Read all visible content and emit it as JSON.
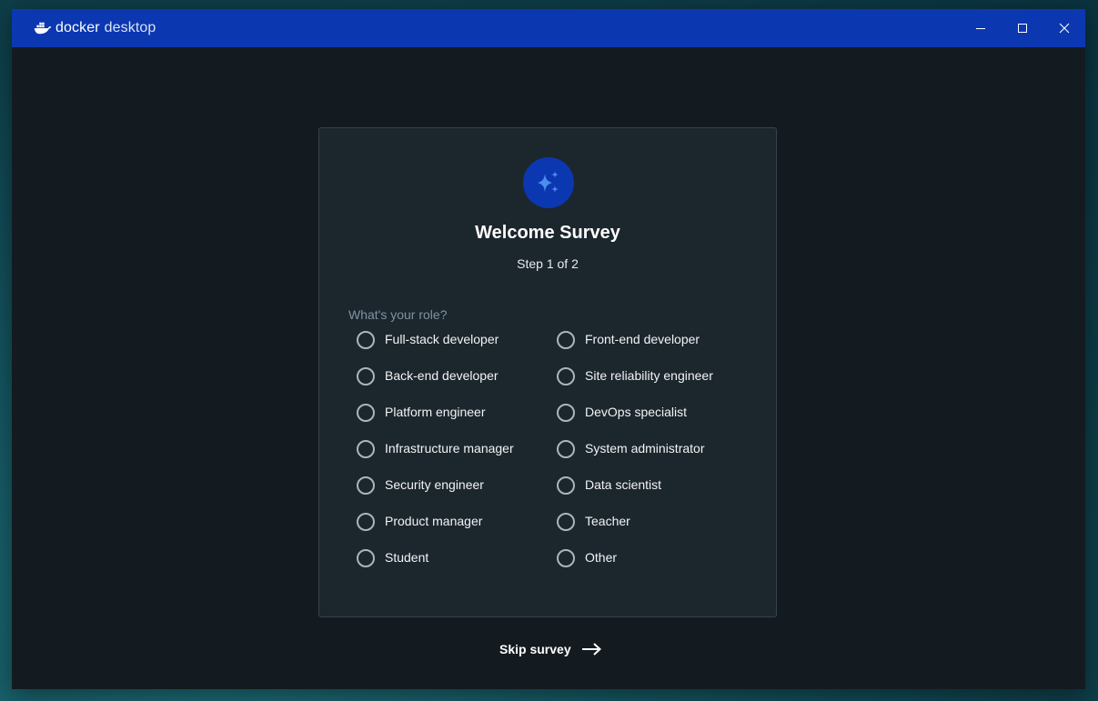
{
  "app": {
    "brand_name": "docker",
    "brand_product": "desktop"
  },
  "window_controls": {
    "minimize_icon": "minimize-icon",
    "maximize_icon": "maximize-icon",
    "close_icon": "close-icon"
  },
  "survey": {
    "icon": "sparkles-icon",
    "title": "Welcome Survey",
    "step": "Step 1 of 2",
    "question": "What's your role?",
    "options": [
      {
        "label": "Full-stack developer",
        "selected": false
      },
      {
        "label": "Front-end developer",
        "selected": false
      },
      {
        "label": "Back-end developer",
        "selected": false
      },
      {
        "label": "Site reliability engineer",
        "selected": false
      },
      {
        "label": "Platform engineer",
        "selected": false
      },
      {
        "label": "DevOps specialist",
        "selected": false
      },
      {
        "label": "Infrastructure manager",
        "selected": false
      },
      {
        "label": "System administrator",
        "selected": false
      },
      {
        "label": "Security engineer",
        "selected": false
      },
      {
        "label": "Data scientist",
        "selected": false
      },
      {
        "label": "Product manager",
        "selected": false
      },
      {
        "label": "Teacher",
        "selected": false
      },
      {
        "label": "Student",
        "selected": false
      },
      {
        "label": "Other",
        "selected": false
      }
    ],
    "skip_label": "Skip survey",
    "skip_icon": "arrow-right-icon"
  },
  "colors": {
    "titlebar": "#0b38b1",
    "window_bg": "#141b20",
    "card_bg": "#1c262d",
    "question_text": "#7d93a6",
    "accent_icon": "#4d8df0"
  }
}
